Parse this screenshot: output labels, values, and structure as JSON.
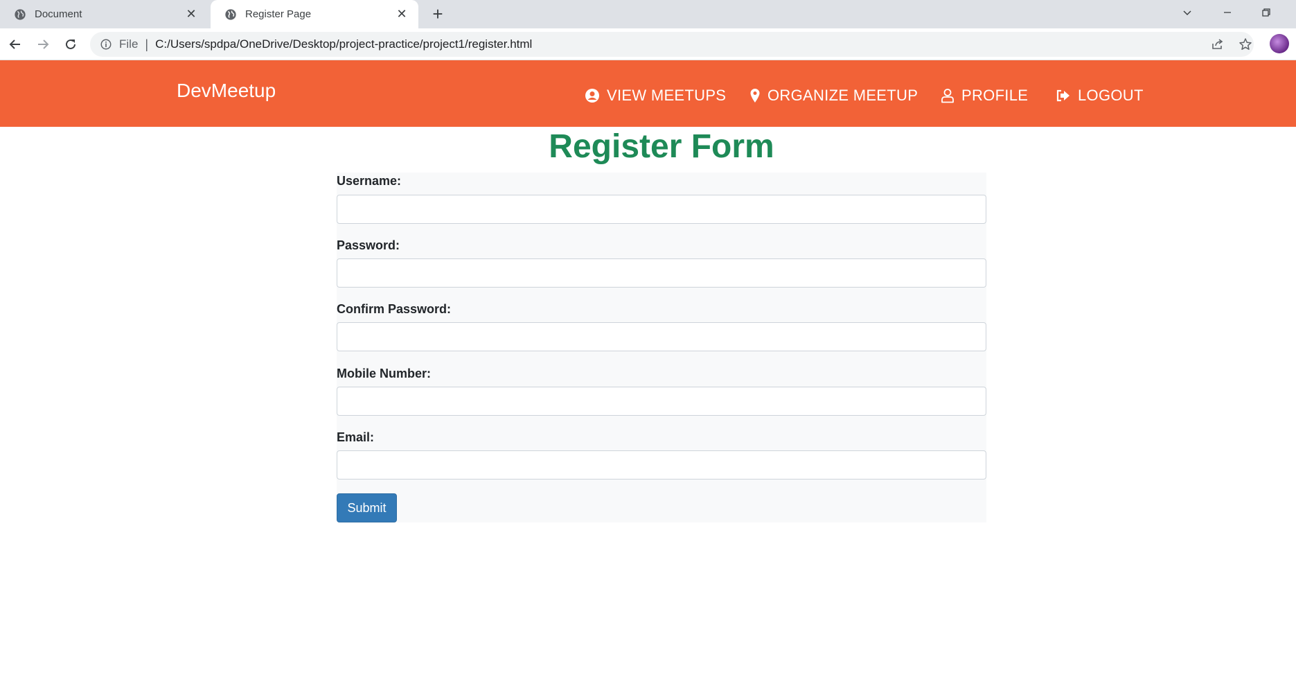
{
  "browser": {
    "tabs": [
      {
        "title": "Document",
        "close": "✕"
      },
      {
        "title": "Register Page",
        "close": "✕"
      }
    ],
    "new_tab": "+",
    "address": {
      "scheme_label": "File",
      "separator": "|",
      "url": "C:/Users/spdpa/OneDrive/Desktop/project-practice/project1/register.html"
    }
  },
  "header": {
    "brand": "DevMeetup",
    "nav": [
      {
        "label": "VIEW MEETUPS",
        "icon": "user-circle-icon"
      },
      {
        "label": "ORGANIZE MEETUP",
        "icon": "map-pin-icon"
      },
      {
        "label": "PROFILE",
        "icon": "user-icon"
      },
      {
        "label": "LOGOUT",
        "icon": "logout-icon"
      }
    ],
    "color": "#f26237"
  },
  "form": {
    "title": "Register Form",
    "title_color": "#1e8a57",
    "fields": [
      {
        "label": "Username:",
        "value": ""
      },
      {
        "label": "Password:",
        "value": ""
      },
      {
        "label": "Confirm Password:",
        "value": ""
      },
      {
        "label": "Mobile Number:",
        "value": ""
      },
      {
        "label": "Email:",
        "value": ""
      }
    ],
    "submit_label": "Submit",
    "submit_color": "#337ab7"
  }
}
